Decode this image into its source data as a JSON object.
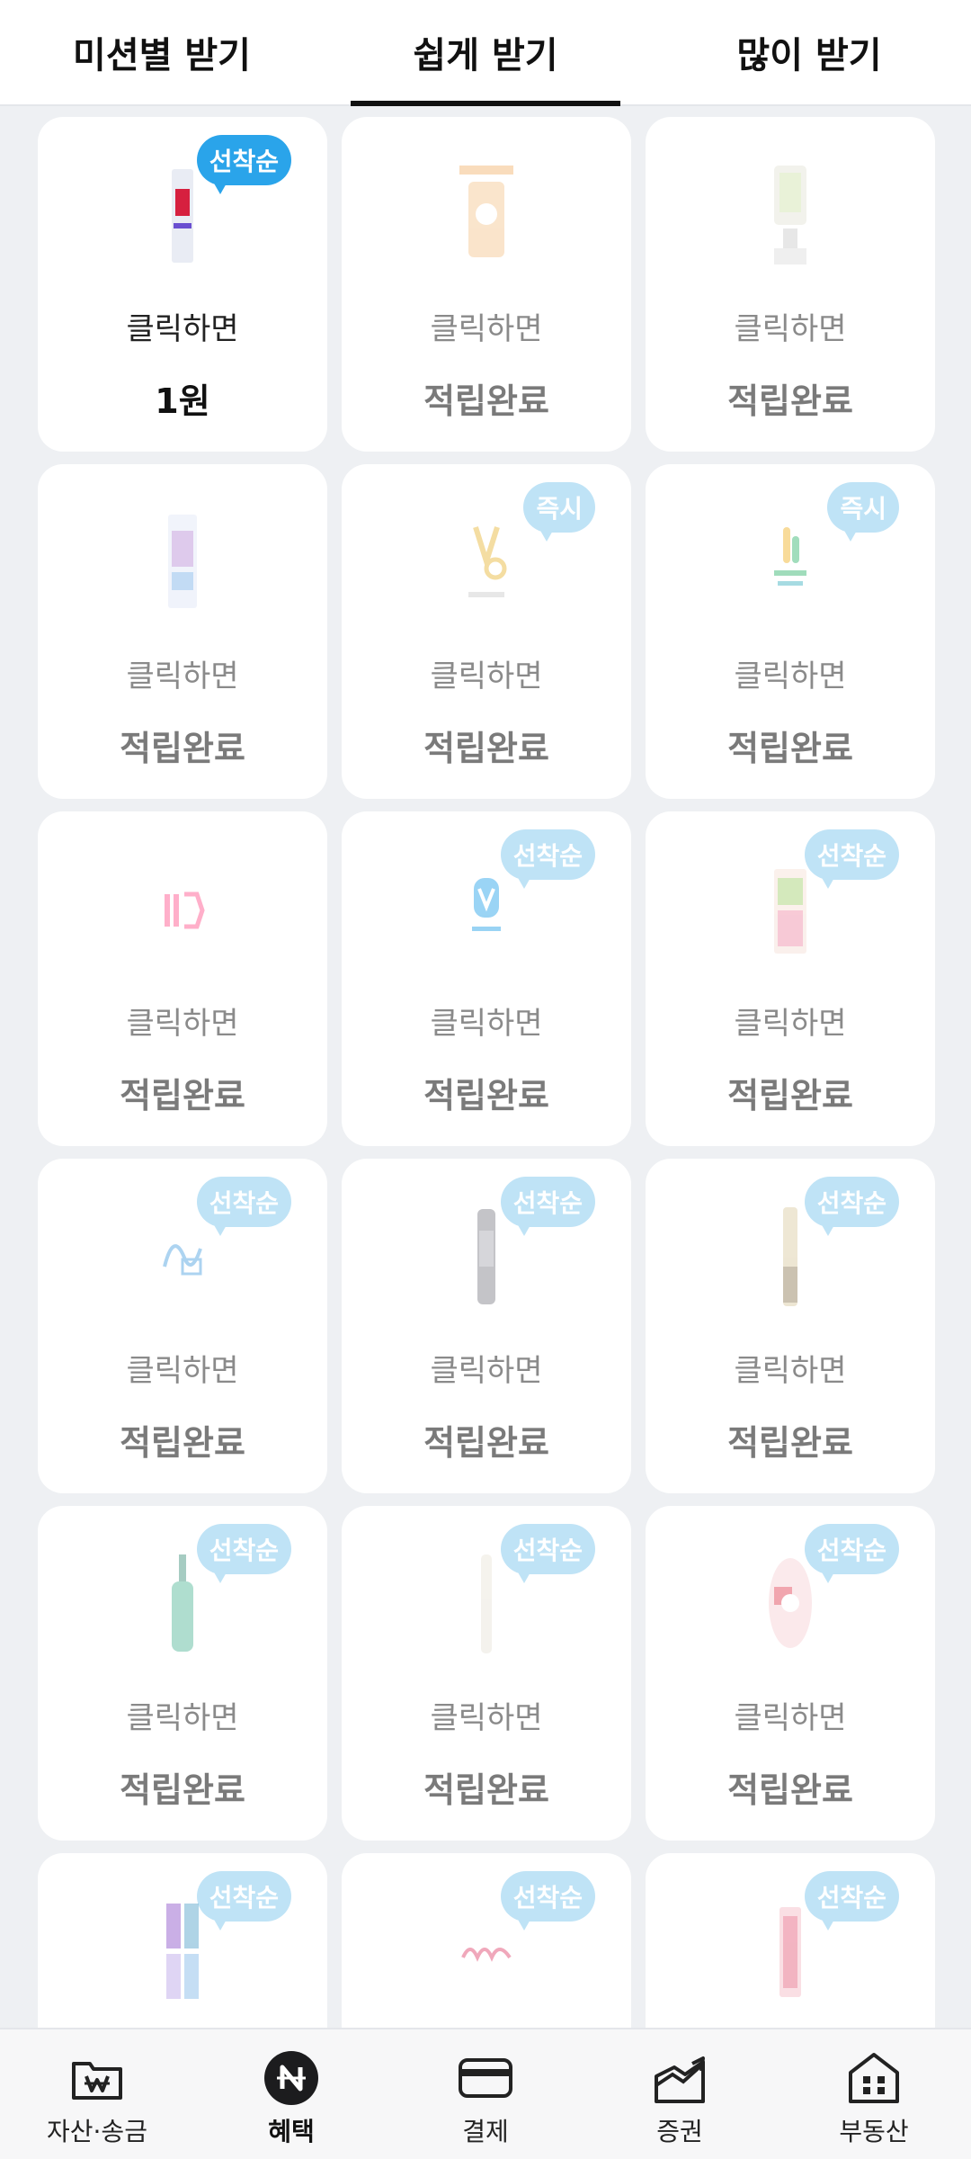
{
  "tabs": [
    {
      "label": "미션별 받기"
    },
    {
      "label": "쉽게 받기"
    },
    {
      "label": "많이 받기"
    }
  ],
  "cards": [
    {
      "caption": "클릭하면",
      "value": "1원",
      "badge": "선착순",
      "done": false,
      "icon": "product-icon"
    },
    {
      "caption": "클릭하면",
      "value": "적립완료",
      "badge": "",
      "done": true,
      "icon": "product-icon"
    },
    {
      "caption": "클릭하면",
      "value": "적립완료",
      "badge": "",
      "done": true,
      "icon": "product-icon"
    },
    {
      "caption": "클릭하면",
      "value": "적립완료",
      "badge": "",
      "done": true,
      "icon": "product-icon"
    },
    {
      "caption": "클릭하면",
      "value": "적립완료",
      "badge": "즉시",
      "done": true,
      "icon": "brand-logo-icon"
    },
    {
      "caption": "클릭하면",
      "value": "적립완료",
      "badge": "즉시",
      "done": true,
      "icon": "brand-logo-icon"
    },
    {
      "caption": "클릭하면",
      "value": "적립완료",
      "badge": "",
      "done": true,
      "icon": "brand-logo-icon"
    },
    {
      "caption": "클릭하면",
      "value": "적립완료",
      "badge": "선착순",
      "done": true,
      "icon": "brand-logo-icon"
    },
    {
      "caption": "클릭하면",
      "value": "적립완료",
      "badge": "선착순",
      "done": true,
      "icon": "product-icon"
    },
    {
      "caption": "클릭하면",
      "value": "적립완료",
      "badge": "선착순",
      "done": true,
      "icon": "brand-logo-icon"
    },
    {
      "caption": "클릭하면",
      "value": "적립완료",
      "badge": "선착순",
      "done": true,
      "icon": "product-icon"
    },
    {
      "caption": "클릭하면",
      "value": "적립완료",
      "badge": "선착순",
      "done": true,
      "icon": "product-icon"
    },
    {
      "caption": "클릭하면",
      "value": "적립완료",
      "badge": "선착순",
      "done": true,
      "icon": "product-icon"
    },
    {
      "caption": "클릭하면",
      "value": "적립완료",
      "badge": "선착순",
      "done": true,
      "icon": "product-icon"
    },
    {
      "caption": "클릭하면",
      "value": "적립완료",
      "badge": "선착순",
      "done": true,
      "icon": "product-icon"
    },
    {
      "caption": "",
      "value": "",
      "badge": "선착순",
      "done": true,
      "icon": "product-icon"
    },
    {
      "caption": "",
      "value": "",
      "badge": "선착순",
      "done": true,
      "icon": "brand-logo-icon"
    },
    {
      "caption": "",
      "value": "",
      "badge": "선착순",
      "done": true,
      "icon": "product-icon"
    }
  ],
  "nav": [
    {
      "label": "자산·송금",
      "icon": "wallet-folder-icon",
      "active": false
    },
    {
      "label": "혜택",
      "icon": "benefit-coin-icon",
      "active": true
    },
    {
      "label": "결제",
      "icon": "card-icon",
      "active": false
    },
    {
      "label": "증권",
      "icon": "stock-chart-icon",
      "active": false
    },
    {
      "label": "부동산",
      "icon": "house-icon",
      "active": false
    }
  ],
  "colors": {
    "badge": "#2aa4ea",
    "background": "#eef0f3"
  }
}
